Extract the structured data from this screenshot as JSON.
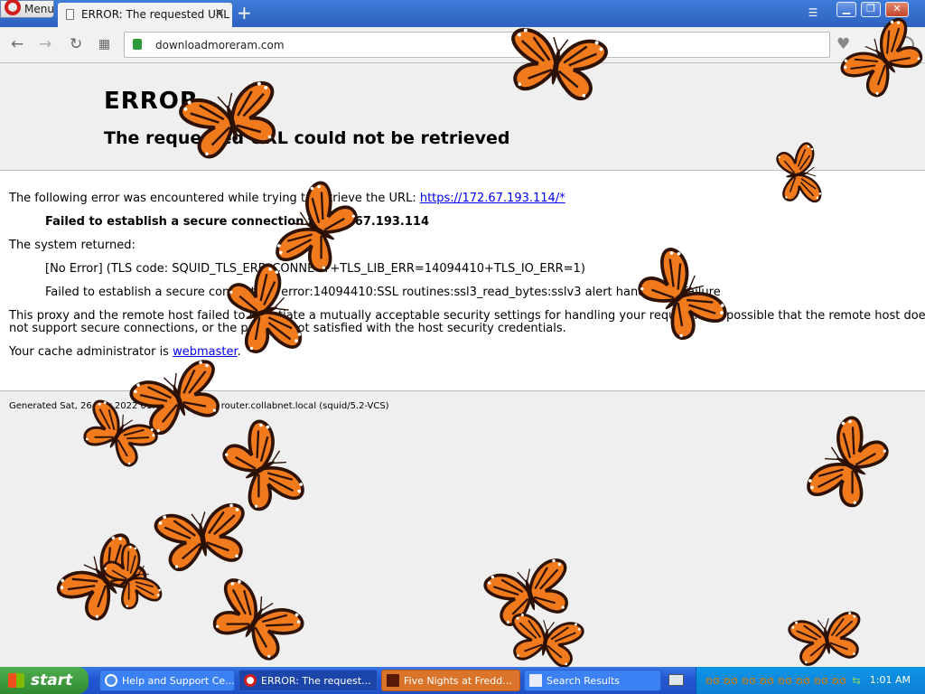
{
  "browser": {
    "menu_label": "Menu",
    "tab_title": "ERROR: The requested URL",
    "new_tab_symbol": "+",
    "url": "downloadmoreram.com"
  },
  "page": {
    "heading": "ERROR",
    "subheading": "The requested URL could not be retrieved",
    "intro_text": "The following error was encountered while trying to retrieve the URL: ",
    "url_link": "https://172.67.193.114/*",
    "error_title": "Failed to establish a secure connection to 172.67.193.114",
    "system_returned": "The system returned:",
    "error_code": "[No Error] (TLS code: SQUID_TLS_ERR_CONNECT+TLS_LIB_ERR=14094410+TLS_IO_ERR=1)",
    "error_detail": "Failed to establish a secure connection: error:14094410:SSL routines:ssl3_read_bytes:sslv3 alert handshake failure",
    "proxy_line1": "This proxy and the remote host failed to negotiate a mutually acceptable security settings for handling your request. It is possible that the remote host does",
    "proxy_line2": "not support secure connections, or the proxy is not satisfied with the host security credentials.",
    "admin_text": "Your cache administrator is ",
    "admin_link": "webmaster",
    "admin_suffix": ".",
    "generated": "Generated Sat, 26 Mar 2022 01:01:01 GMT by router.collabnet.local (squid/5.2-VCS)"
  },
  "taskbar": {
    "start_label": "start",
    "tasks": [
      {
        "label": "Help and Support Ce..."
      },
      {
        "label": "ERROR: The request..."
      },
      {
        "label": "Five Nights at Fredd..."
      },
      {
        "label": "Search Results"
      }
    ],
    "clock": "1:01 AM"
  },
  "colors": {
    "butterfly_orange": "#f07a1c",
    "butterfly_dark": "#3a1608",
    "link_blue": "#0000ee",
    "taskbar_blue": "#2458d3"
  }
}
